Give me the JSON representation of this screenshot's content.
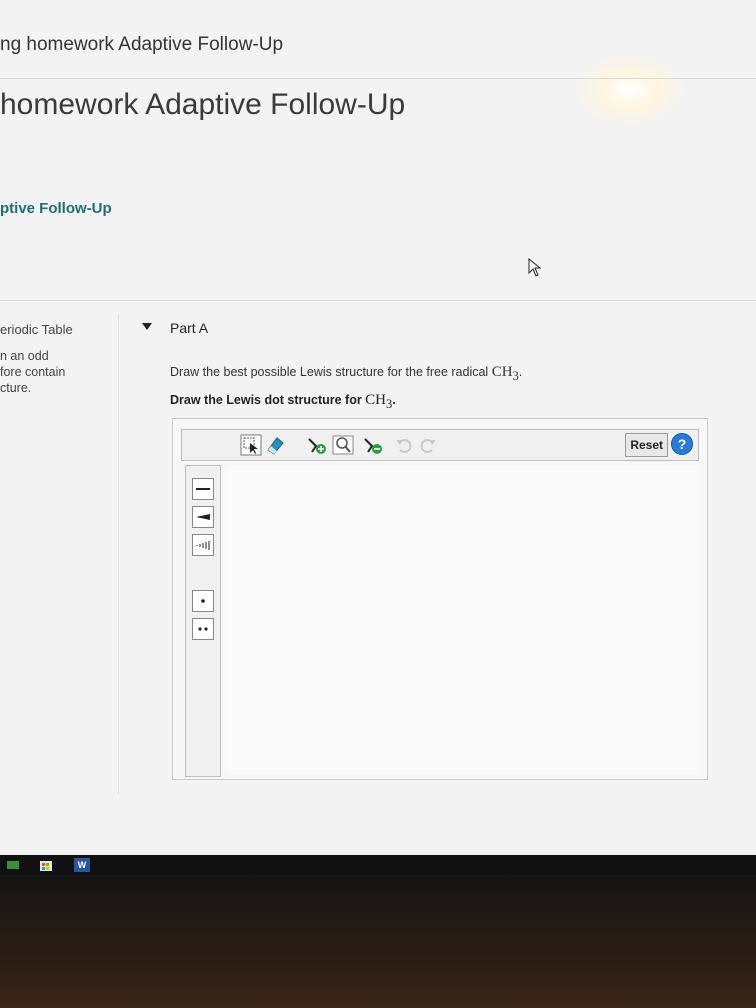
{
  "breadcrumb": "ng homework Adaptive Follow-Up",
  "page_title": "homework Adaptive Follow-Up",
  "sub_title": "ptive Follow-Up",
  "side": {
    "periodic_table_link": "eriodic Table",
    "lines": [
      "n an odd",
      "fore contain",
      "cture."
    ]
  },
  "part": {
    "label": "Part A",
    "question_text": "Draw the best possible Lewis structure for the free radical ",
    "instruction_text": "Draw the Lewis dot structure for ",
    "formula_base": "CH",
    "formula_sub": "3",
    "formula_end": "."
  },
  "editor": {
    "reset_label": "Reset",
    "help_label": "?",
    "tools": [
      "select-arrow-icon",
      "eraser-icon",
      "add-atom-icon",
      "zoom-icon",
      "add-charge-icon",
      "undo-icon",
      "redo-icon"
    ],
    "left_tools": [
      "single-bond-icon",
      "wedge-bond-icon",
      "hash-bond-icon",
      "lone-electron-icon",
      "electron-pair-icon"
    ]
  },
  "taskbar": {
    "word_label": "W"
  },
  "colors": {
    "accent": "#1e6e78",
    "help_blue": "#2b7bd6"
  }
}
